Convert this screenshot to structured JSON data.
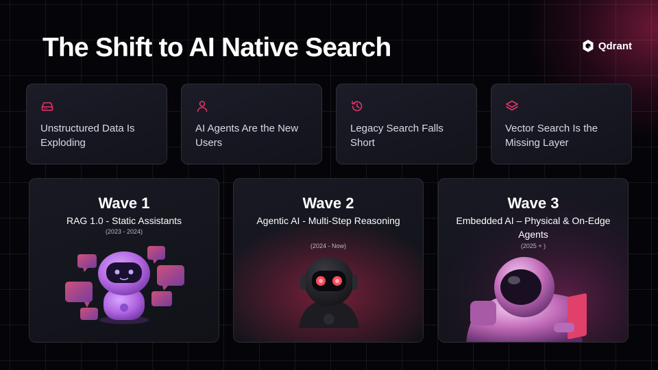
{
  "slide": {
    "title": "The Shift to AI Native Search",
    "brand": {
      "name": "Qdrant",
      "icon": "qdrant-logo-icon"
    }
  },
  "top_cards": [
    {
      "icon": "drive-icon",
      "label": "Unstructured Data Is Exploding"
    },
    {
      "icon": "user-icon",
      "label": "AI Agents Are the New Users"
    },
    {
      "icon": "history-icon",
      "label": "Legacy Search Falls Short"
    },
    {
      "icon": "layers-icon",
      "label": "Vector Search Is the Missing Layer"
    }
  ],
  "waves": [
    {
      "title": "Wave 1",
      "subtitle": "RAG 1.0 - Static Assistants",
      "dates": "(2023 - 2024)",
      "image": "chat-robot-illustration"
    },
    {
      "title": "Wave 2",
      "subtitle": "Agentic AI - Multi-Step Reasoning",
      "dates": "(2024 - Now)",
      "image": "agent-robot-illustration"
    },
    {
      "title": "Wave 3",
      "subtitle": "Embedded AI – Physical & On-Edge Agents",
      "dates": "(2025 + )",
      "image": "astronaut-illustration"
    }
  ],
  "colors": {
    "accent": "#e8336d",
    "background": "#050408",
    "card": "#171822"
  }
}
